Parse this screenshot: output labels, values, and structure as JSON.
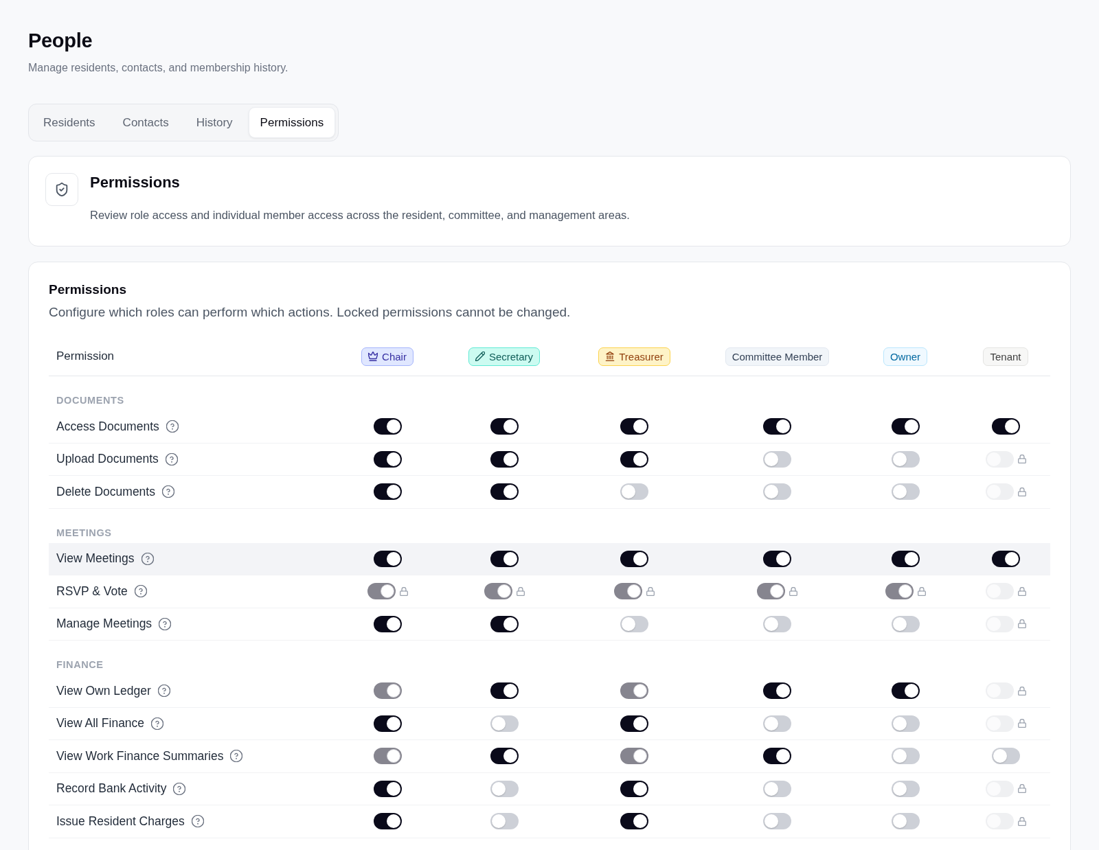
{
  "page": {
    "title": "People",
    "subtitle": "Manage residents, contacts, and membership history."
  },
  "tabs": [
    {
      "label": "Residents",
      "selected": false
    },
    {
      "label": "Contacts",
      "selected": false
    },
    {
      "label": "History",
      "selected": false
    },
    {
      "label": "Permissions",
      "selected": true
    }
  ],
  "intro_card": {
    "title": "Permissions",
    "description": "Review role access and individual member access across the resident, committee, and management areas."
  },
  "permissions_card": {
    "title": "Permissions",
    "description": "Configure which roles can perform which actions. Locked permissions cannot be changed.",
    "column_header": "Permission",
    "roles": [
      {
        "label": "Chair",
        "kind": "chair",
        "color": "#3730a3"
      },
      {
        "label": "Secretary",
        "kind": "secretary",
        "color": "#115e59"
      },
      {
        "label": "Treasurer",
        "kind": "treasurer",
        "color": "#92400e"
      },
      {
        "label": "Committee Member",
        "kind": "committee",
        "color": "#334155"
      },
      {
        "label": "Owner",
        "kind": "owner",
        "color": "#0369a1"
      },
      {
        "label": "Tenant",
        "kind": "tenant",
        "color": "#404040"
      }
    ],
    "sections": [
      {
        "label": "DOCUMENTS",
        "rows": [
          {
            "label": "Access Documents",
            "highlighted": false,
            "cells": [
              {
                "kind": "open",
                "on": true,
                "disabled": false
              },
              {
                "kind": "open",
                "on": true,
                "disabled": false
              },
              {
                "kind": "open",
                "on": true,
                "disabled": false
              },
              {
                "kind": "open",
                "on": true,
                "disabled": false
              },
              {
                "kind": "open",
                "on": true,
                "disabled": false
              },
              {
                "kind": "open",
                "on": true,
                "disabled": false
              }
            ]
          },
          {
            "label": "Upload Documents",
            "highlighted": false,
            "cells": [
              {
                "kind": "open",
                "on": true,
                "disabled": false
              },
              {
                "kind": "open",
                "on": true,
                "disabled": false
              },
              {
                "kind": "open",
                "on": true,
                "disabled": false
              },
              {
                "kind": "open",
                "on": false,
                "disabled": false
              },
              {
                "kind": "open",
                "on": false,
                "disabled": false
              },
              {
                "kind": "locked",
                "on": false,
                "disabled": true
              }
            ]
          },
          {
            "label": "Delete Documents",
            "highlighted": false,
            "cells": [
              {
                "kind": "open",
                "on": true,
                "disabled": false
              },
              {
                "kind": "open",
                "on": true,
                "disabled": false
              },
              {
                "kind": "open",
                "on": false,
                "disabled": false
              },
              {
                "kind": "open",
                "on": false,
                "disabled": false
              },
              {
                "kind": "open",
                "on": false,
                "disabled": false
              },
              {
                "kind": "locked",
                "on": false,
                "disabled": true
              }
            ]
          }
        ]
      },
      {
        "label": "MEETINGS",
        "rows": [
          {
            "label": "View Meetings",
            "highlighted": true,
            "cells": [
              {
                "kind": "open",
                "on": true,
                "disabled": false
              },
              {
                "kind": "open",
                "on": true,
                "disabled": false
              },
              {
                "kind": "open",
                "on": true,
                "disabled": false
              },
              {
                "kind": "open",
                "on": true,
                "disabled": false
              },
              {
                "kind": "open",
                "on": true,
                "disabled": false
              },
              {
                "kind": "open",
                "on": true,
                "disabled": false
              }
            ]
          },
          {
            "label": "RSVP & Vote",
            "highlighted": false,
            "cells": [
              {
                "kind": "locked",
                "on": true,
                "disabled": true
              },
              {
                "kind": "locked",
                "on": true,
                "disabled": true
              },
              {
                "kind": "locked",
                "on": true,
                "disabled": true
              },
              {
                "kind": "locked",
                "on": true,
                "disabled": true
              },
              {
                "kind": "locked",
                "on": true,
                "disabled": true
              },
              {
                "kind": "locked",
                "on": false,
                "disabled": true
              }
            ]
          },
          {
            "label": "Manage Meetings",
            "highlighted": false,
            "cells": [
              {
                "kind": "open",
                "on": true,
                "disabled": false
              },
              {
                "kind": "open",
                "on": true,
                "disabled": false
              },
              {
                "kind": "open",
                "on": false,
                "disabled": false
              },
              {
                "kind": "open",
                "on": false,
                "disabled": false
              },
              {
                "kind": "open",
                "on": false,
                "disabled": false
              },
              {
                "kind": "locked",
                "on": false,
                "disabled": true
              }
            ]
          }
        ]
      },
      {
        "label": "FINANCE",
        "rows": [
          {
            "label": "View Own Ledger",
            "highlighted": false,
            "cells": [
              {
                "kind": "open",
                "on": true,
                "disabled": true
              },
              {
                "kind": "open",
                "on": true,
                "disabled": false
              },
              {
                "kind": "open",
                "on": true,
                "disabled": true
              },
              {
                "kind": "open",
                "on": true,
                "disabled": false
              },
              {
                "kind": "open",
                "on": true,
                "disabled": false
              },
              {
                "kind": "locked",
                "on": false,
                "disabled": true
              }
            ]
          },
          {
            "label": "View All Finance",
            "highlighted": false,
            "cells": [
              {
                "kind": "open",
                "on": true,
                "disabled": false
              },
              {
                "kind": "open",
                "on": false,
                "disabled": false
              },
              {
                "kind": "open",
                "on": true,
                "disabled": false
              },
              {
                "kind": "open",
                "on": false,
                "disabled": false
              },
              {
                "kind": "open",
                "on": false,
                "disabled": false
              },
              {
                "kind": "locked",
                "on": false,
                "disabled": true
              }
            ]
          },
          {
            "label": "View Work Finance Summaries",
            "highlighted": false,
            "cells": [
              {
                "kind": "open",
                "on": true,
                "disabled": true
              },
              {
                "kind": "open",
                "on": true,
                "disabled": false
              },
              {
                "kind": "open",
                "on": true,
                "disabled": true
              },
              {
                "kind": "open",
                "on": true,
                "disabled": false
              },
              {
                "kind": "open",
                "on": false,
                "disabled": false
              },
              {
                "kind": "open",
                "on": false,
                "disabled": false
              }
            ]
          },
          {
            "label": "Record Bank Activity",
            "highlighted": false,
            "cells": [
              {
                "kind": "open",
                "on": true,
                "disabled": false
              },
              {
                "kind": "open",
                "on": false,
                "disabled": false
              },
              {
                "kind": "open",
                "on": true,
                "disabled": false
              },
              {
                "kind": "open",
                "on": false,
                "disabled": false
              },
              {
                "kind": "open",
                "on": false,
                "disabled": false
              },
              {
                "kind": "locked",
                "on": false,
                "disabled": true
              }
            ]
          },
          {
            "label": "Issue Resident Charges",
            "highlighted": false,
            "cells": [
              {
                "kind": "open",
                "on": true,
                "disabled": false
              },
              {
                "kind": "open",
                "on": false,
                "disabled": false
              },
              {
                "kind": "open",
                "on": true,
                "disabled": false
              },
              {
                "kind": "open",
                "on": false,
                "disabled": false
              },
              {
                "kind": "open",
                "on": false,
                "disabled": false
              },
              {
                "kind": "locked",
                "on": false,
                "disabled": true
              }
            ]
          }
        ]
      }
    ]
  }
}
